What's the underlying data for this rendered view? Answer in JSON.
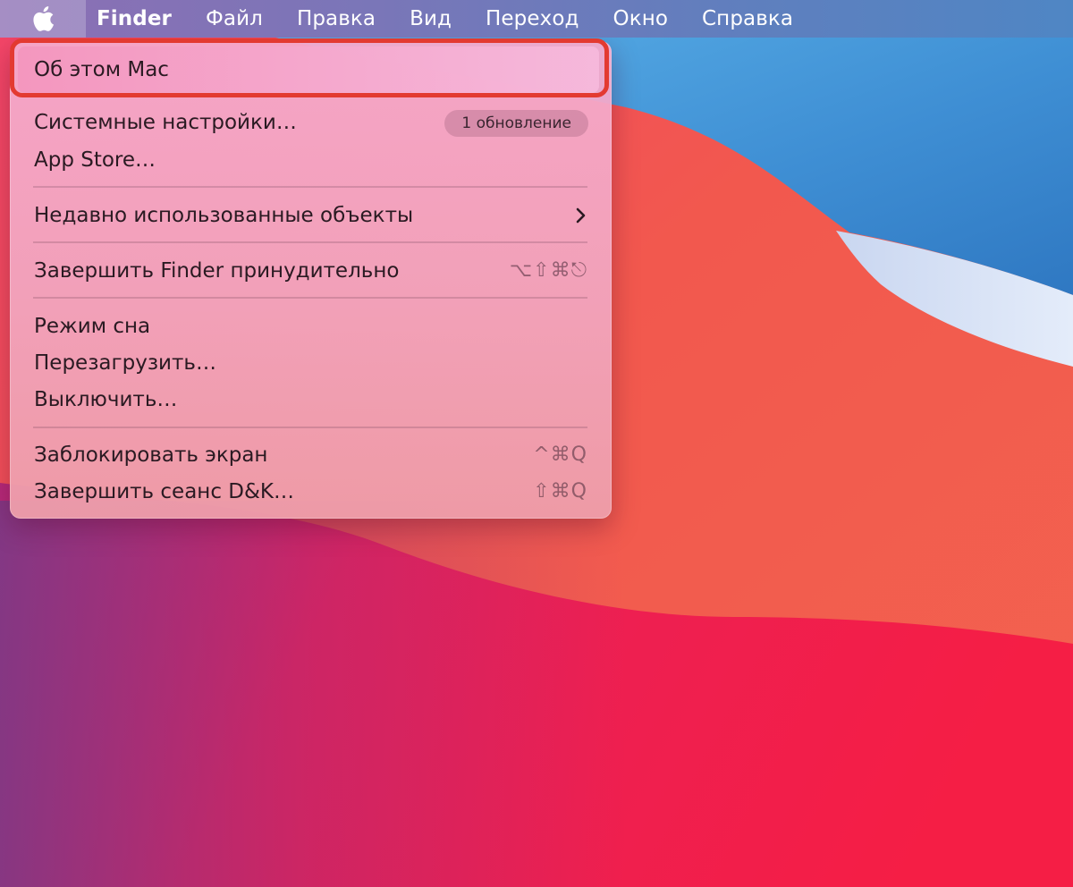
{
  "menubar": {
    "apple_icon": "apple-logo-icon",
    "app_name": "Finder",
    "menus": [
      "Файл",
      "Правка",
      "Вид",
      "Переход",
      "Окно",
      "Справка"
    ]
  },
  "apple_menu": {
    "about": "Об этом Mac",
    "system_prefs": "Системные настройки…",
    "system_prefs_badge": "1 обновление",
    "app_store": "App Store…",
    "recent_items": "Недавно использованные объекты",
    "force_quit": "Завершить Finder принудительно",
    "force_quit_shortcut": "⌥⇧⌘⎋",
    "sleep": "Режим сна",
    "restart": "Перезагрузить…",
    "shutdown": "Выключить…",
    "lock_screen": "Заблокировать экран",
    "lock_screen_shortcut": "^⌘Q",
    "logout": "Завершить сеанс D&K…",
    "logout_shortcut": "⇧⌘Q"
  },
  "colors": {
    "highlight_ring": "#e33a31",
    "wallpaper_red": "#f0284f",
    "wallpaper_blue": "#3f8fd4"
  }
}
